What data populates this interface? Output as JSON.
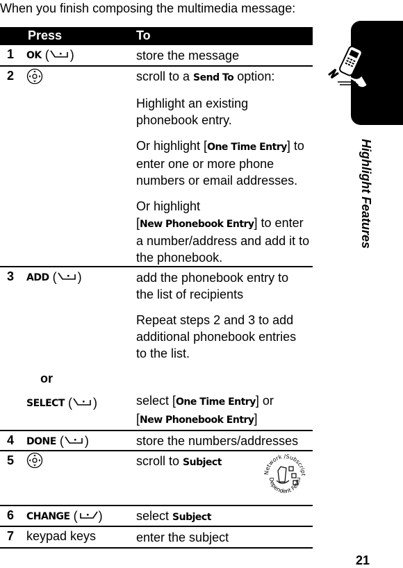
{
  "intro": "When you finish composing the multimedia message:",
  "table": {
    "headers": {
      "press": "Press",
      "to": "To"
    },
    "rows": [
      {
        "num": "1",
        "key": "OK",
        "key_icon": "left-soft-key-icon",
        "to": [
          "store the message"
        ]
      },
      {
        "num": "2",
        "key_icon": "nav-key-icon",
        "to_rich": [
          [
            "scroll to a ",
            {
              "kw": "Send To"
            },
            " option:"
          ],
          [
            "Highlight an existing phonebook entry."
          ],
          [
            "Or highlight [",
            {
              "kw": "One Time Entry"
            },
            "] to enter one or more phone numbers or email addresses."
          ],
          [
            "Or highlight [",
            {
              "kw": "New Phonebook Entry"
            },
            "] to enter a number/address and add it to the phonebook."
          ]
        ]
      },
      {
        "num": "3",
        "key": "ADD",
        "key_icon": "left-soft-key-icon",
        "to": [
          "add the phonebook entry to the list of recipients",
          "Repeat steps 2 and 3 to add additional phonebook entries to the list."
        ],
        "or_label": "or",
        "alt_key": "SELECT",
        "alt_to": [
          "select [",
          {
            "kw": "One Time Entry"
          },
          "] or [",
          {
            "kw": "New Phonebook Entry"
          },
          "]"
        ]
      },
      {
        "num": "4",
        "key": "DONE",
        "key_icon": "left-soft-key-icon",
        "to": [
          "store the numbers/addresses"
        ]
      },
      {
        "num": "5",
        "key_icon": "nav-key-icon",
        "to_rich": [
          [
            "scroll to ",
            {
              "kw": "Subject"
            }
          ]
        ],
        "badge": {
          "top": "Network /Subscription",
          "bottom": "Dependent Feature"
        }
      },
      {
        "num": "6",
        "key": "CHANGE",
        "key_icon": "right-soft-key-icon",
        "to_rich": [
          [
            "select ",
            {
              "kw": "Subject"
            }
          ]
        ]
      },
      {
        "num": "7",
        "key_text": "keypad keys",
        "to": [
          "enter the subject"
        ]
      }
    ]
  },
  "side_tab": {
    "title": "Highlight Features",
    "icon": "running-phone-icon"
  },
  "page_number": "21"
}
